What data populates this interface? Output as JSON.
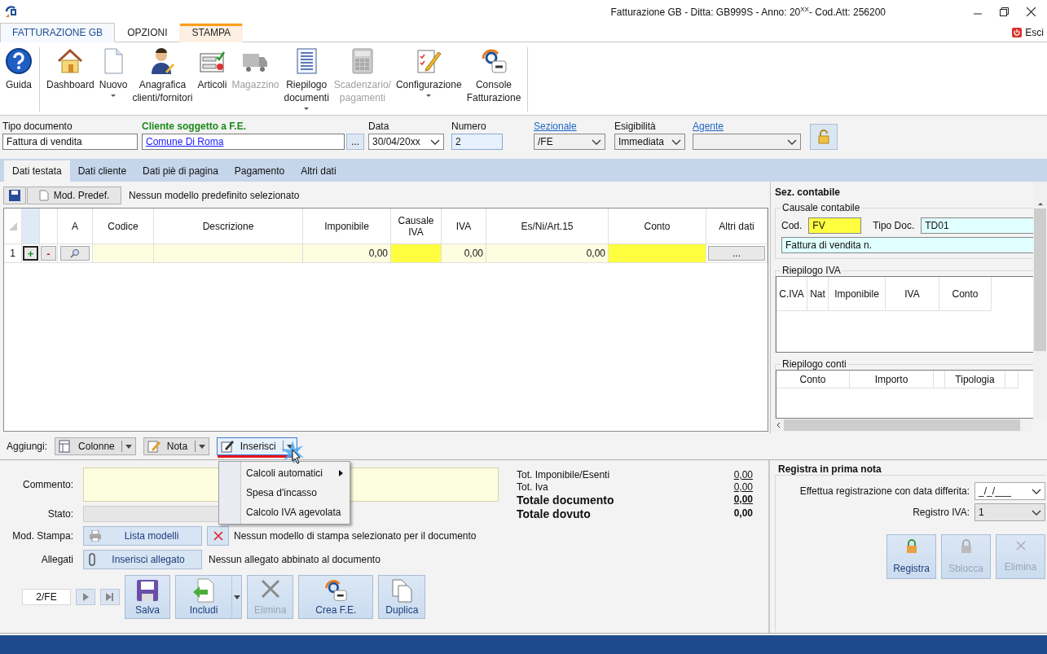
{
  "window": {
    "title": "Fatturazione GB - Ditta: GB999S - Anno: 20$^{XX}$- Cod.Att: 256200"
  },
  "ribbon_tabs": [
    {
      "label": "FATTURAZIONE GB",
      "selected": true,
      "contextual": false
    },
    {
      "label": "OPZIONI",
      "selected": false,
      "contextual": false
    },
    {
      "label": "STAMPA",
      "selected": false,
      "contextual": true
    }
  ],
  "exit_button": {
    "label": "Esci"
  },
  "ribbon_buttons": [
    {
      "label": "Guida",
      "disabled": false,
      "dropdown": false
    },
    {
      "label": "Dashboard",
      "disabled": false,
      "dropdown": false
    },
    {
      "label": "Nuovo",
      "disabled": false,
      "dropdown": true
    },
    {
      "label": "Anagrafica\nclienti/fornitori",
      "disabled": false,
      "dropdown": false
    },
    {
      "label": "Articoli",
      "disabled": false,
      "dropdown": false
    },
    {
      "label": "Magazzino",
      "disabled": true,
      "dropdown": false
    },
    {
      "label": "Riepilogo\ndocumenti",
      "disabled": false,
      "dropdown": true
    },
    {
      "label": "Scadenzario/\npagamenti",
      "disabled": true,
      "dropdown": false
    },
    {
      "label": "Configurazione",
      "disabled": false,
      "dropdown": true
    },
    {
      "label": "Console\nFatturazione",
      "disabled": false,
      "dropdown": false
    }
  ],
  "document_header": {
    "tipo_documento": {
      "label": "Tipo documento",
      "value": "Fattura di vendita"
    },
    "cliente": {
      "label": "Cliente soggetto a F.E.",
      "value": "Comune Di Roma",
      "browse": "..."
    },
    "data": {
      "label": "Data",
      "value": "30/04/20xx"
    },
    "numero": {
      "label": "Numero",
      "value": "2"
    },
    "sezionale": {
      "label": "Sezionale",
      "value": "/FE"
    },
    "esigibilita": {
      "label": "Esigibilità",
      "value": "Immediata"
    },
    "agente": {
      "label": "Agente"
    }
  },
  "form_tabs": [
    {
      "label": "Dati testata",
      "selected": true
    },
    {
      "label": "Dati cliente",
      "selected": false
    },
    {
      "label": "Dati piè di pagina",
      "selected": false
    },
    {
      "label": "Pagamento",
      "selected": false
    },
    {
      "label": "Altri dati",
      "selected": false
    }
  ],
  "model_bar": {
    "button": "Mod. Predef.",
    "message": "Nessun modello predefinito selezionato"
  },
  "grid": {
    "columns": [
      "A",
      "Codice",
      "Descrizione",
      "Imponibile",
      "Causale\nIVA",
      "IVA",
      "Es/Ni/Art.15",
      "Conto",
      "Altri dati"
    ],
    "rows": [
      {
        "number": "1",
        "add": "+",
        "remove": "-",
        "imponibile": "0,00",
        "iva": "0,00",
        "es_ni_art15": "0,00",
        "altri_dati": "..."
      }
    ]
  },
  "sez_contabile": {
    "title": "Sez. contabile",
    "causale": {
      "title": "Causale contabile",
      "cod_label": "Cod.",
      "cod_value": "FV",
      "tipo_doc_label": "Tipo Doc.",
      "tipo_doc_value": "TD01",
      "description": "Fattura di vendita n."
    },
    "riepilogo_iva": {
      "title": "Riepilogo IVA",
      "columns": [
        "C.IVA",
        "Nat",
        "Imponibile",
        "IVA",
        "Conto"
      ]
    },
    "riepilogo_conti": {
      "title": "Riepilogo conti",
      "columns": [
        "Conto",
        "Importo",
        "Tipologia"
      ]
    }
  },
  "add_bar": {
    "label": "Aggiungi:",
    "buttons": [
      {
        "label": "Colonne",
        "highlighted": false
      },
      {
        "label": "Nota",
        "highlighted": false
      },
      {
        "label": "Inserisci",
        "highlighted": true
      }
    ]
  },
  "context_menu": [
    {
      "label": "Calcoli automatici",
      "submenu": true
    },
    {
      "label": "Spesa d'incasso",
      "submenu": false
    },
    {
      "label": "Calcolo IVA agevolata",
      "submenu": false
    }
  ],
  "footer": {
    "commento_label": "Commento:",
    "stato_label": "Stato:",
    "mod_stampa": {
      "label": "Mod. Stampa:",
      "button": "Lista modelli",
      "message": "Nessun modello di stampa selezionato per il documento"
    },
    "allegati": {
      "label": "Allegati",
      "button": "Inserisci allegato",
      "message": "Nessun allegato abbinato al documento"
    },
    "navigator": "2/FE",
    "actions": [
      {
        "label": "Salva",
        "disabled": false,
        "dropdown": false
      },
      {
        "label": "Includi",
        "disabled": false,
        "dropdown": true
      },
      {
        "label": "Elimina",
        "disabled": true,
        "dropdown": false
      },
      {
        "label": "Crea F.E.",
        "disabled": false,
        "dropdown": false
      },
      {
        "label": "Duplica",
        "disabled": false,
        "dropdown": false
      }
    ]
  },
  "totals": [
    {
      "label": "Tot. Imponibile/Esenti",
      "value": "0,00",
      "bold": false,
      "underlined": true
    },
    {
      "label": "Tot. Iva",
      "value": "0,00",
      "bold": false,
      "underlined": true
    },
    {
      "label": "Totale documento",
      "value": "0,00",
      "bold": true,
      "underlined": true
    },
    {
      "label": "Totale dovuto",
      "value": "0,00",
      "bold": true,
      "underlined": false
    }
  ],
  "prima_nota": {
    "title": "Registra in prima nota",
    "data_label": "Effettua registrazione con data differita:",
    "data_value": "_/_/___",
    "registro_label": "Registro IVA:",
    "registro_value": "1",
    "buttons": [
      {
        "label": "Registra",
        "disabled": false
      },
      {
        "label": "Sblocca",
        "disabled": true
      },
      {
        "label": "Elimina",
        "disabled": true
      }
    ]
  }
}
